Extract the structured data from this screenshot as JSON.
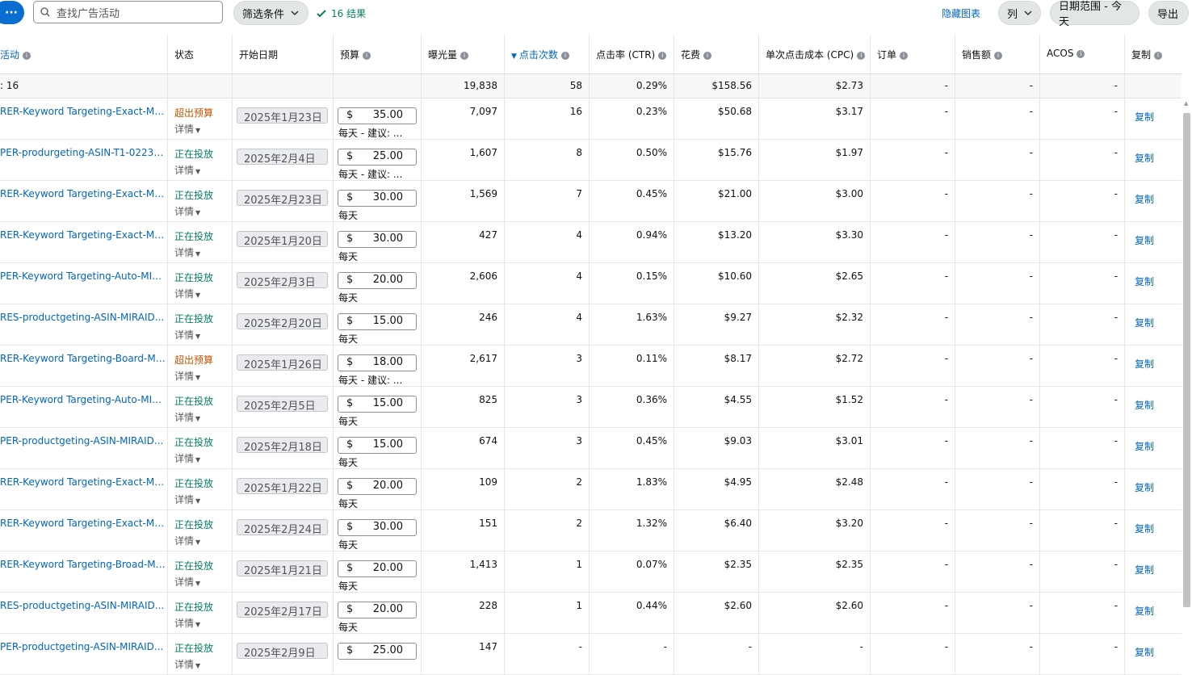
{
  "toolbar": {
    "more_label": "···",
    "search_placeholder": "查找广告活动",
    "filter_label": "筛选条件",
    "results_label": "16 结果",
    "hide_chart": "隐藏图表",
    "columns_label": "列",
    "date_range": "日期范围 - 今天",
    "export_label": "导出"
  },
  "headers": {
    "campaign": "活动",
    "status": "状态",
    "start_date": "开始日期",
    "budget": "预算",
    "impressions": "曝光量",
    "clicks": "点击次数",
    "ctr": "点击率 (CTR)",
    "spend": "花费",
    "cpc": "单次点击成本 (CPC)",
    "orders": "订单",
    "sales": "销售额",
    "acos": "ACOS",
    "copy": "复制"
  },
  "summary": {
    "label": ": 16",
    "impressions": "19,838",
    "clicks": "58",
    "ctr": "0.29%",
    "spend": "$158.56",
    "cpc": "$2.73",
    "orders": "-",
    "sales": "-",
    "acos": "-"
  },
  "detail_label": "详情",
  "copy_label": "复制",
  "currency": "$",
  "rows": [
    {
      "campaign": "RER-Keyword Targeting-Exact-MI...",
      "status": "超出预算",
      "status_type": "over",
      "start": "2025年1月23日",
      "budget": "35.00",
      "budget_note": "每天 - 建议: ...",
      "impressions": "7,097",
      "clicks": "16",
      "ctr": "0.23%",
      "spend": "$50.68",
      "cpc": "$3.17",
      "orders": "-",
      "sales": "-",
      "acos": "-"
    },
    {
      "campaign": "PER-produrgeting-ASIN-T1-0223(...",
      "status": "正在投放",
      "status_type": "on",
      "start": "2025年2月4日",
      "budget": "25.00",
      "budget_note": "每天 - 建议: ...",
      "impressions": "1,607",
      "clicks": "8",
      "ctr": "0.50%",
      "spend": "$15.76",
      "cpc": "$1.97",
      "orders": "-",
      "sales": "-",
      "acos": "-"
    },
    {
      "campaign": "RER-Keyword Targeting-Exact-MI...",
      "status": "正在投放",
      "status_type": "on",
      "start": "2025年2月23日",
      "budget": "30.00",
      "budget_note": "每天",
      "impressions": "1,569",
      "clicks": "7",
      "ctr": "0.45%",
      "spend": "$21.00",
      "cpc": "$3.00",
      "orders": "-",
      "sales": "-",
      "acos": "-"
    },
    {
      "campaign": "RER-Keyword Targeting-Exact-MI...",
      "status": "正在投放",
      "status_type": "on",
      "start": "2025年1月20日",
      "budget": "30.00",
      "budget_note": "每天",
      "impressions": "427",
      "clicks": "4",
      "ctr": "0.94%",
      "spend": "$13.20",
      "cpc": "$3.30",
      "orders": "-",
      "sales": "-",
      "acos": "-"
    },
    {
      "campaign": "PER-Keyword Targeting-Auto-MIR...",
      "status": "正在投放",
      "status_type": "on",
      "start": "2025年2月3日",
      "budget": "20.00",
      "budget_note": "每天",
      "impressions": "2,606",
      "clicks": "4",
      "ctr": "0.15%",
      "spend": "$10.60",
      "cpc": "$2.65",
      "orders": "-",
      "sales": "-",
      "acos": "-"
    },
    {
      "campaign": "RES-productgeting-ASIN-MIRAID...",
      "status": "正在投放",
      "status_type": "on",
      "start": "2025年2月20日",
      "budget": "15.00",
      "budget_note": "每天",
      "impressions": "246",
      "clicks": "4",
      "ctr": "1.63%",
      "spend": "$9.27",
      "cpc": "$2.32",
      "orders": "-",
      "sales": "-",
      "acos": "-"
    },
    {
      "campaign": "RER-Keyword Targeting-Board-MI...",
      "status": "超出预算",
      "status_type": "over",
      "start": "2025年1月26日",
      "budget": "18.00",
      "budget_note": "每天 - 建议: ...",
      "impressions": "2,617",
      "clicks": "3",
      "ctr": "0.11%",
      "spend": "$8.17",
      "cpc": "$2.72",
      "orders": "-",
      "sales": "-",
      "acos": "-"
    },
    {
      "campaign": "PER-Keyword Targeting-Auto-MIR...",
      "status": "正在投放",
      "status_type": "on",
      "start": "2025年2月5日",
      "budget": "15.00",
      "budget_note": "每天",
      "impressions": "825",
      "clicks": "3",
      "ctr": "0.36%",
      "spend": "$4.55",
      "cpc": "$1.52",
      "orders": "-",
      "sales": "-",
      "acos": "-"
    },
    {
      "campaign": "PER-productgeting-ASIN-MIRAID...",
      "status": "正在投放",
      "status_type": "on",
      "start": "2025年2月18日",
      "budget": "15.00",
      "budget_note": "每天",
      "impressions": "674",
      "clicks": "3",
      "ctr": "0.45%",
      "spend": "$9.03",
      "cpc": "$3.01",
      "orders": "-",
      "sales": "-",
      "acos": "-"
    },
    {
      "campaign": "RER-Keyword Targeting-Exact-MI...",
      "status": "正在投放",
      "status_type": "on",
      "start": "2025年1月22日",
      "budget": "20.00",
      "budget_note": "每天",
      "impressions": "109",
      "clicks": "2",
      "ctr": "1.83%",
      "spend": "$4.95",
      "cpc": "$2.48",
      "orders": "-",
      "sales": "-",
      "acos": "-"
    },
    {
      "campaign": "RER-Keyword Targeting-Exact-MI...",
      "status": "正在投放",
      "status_type": "on",
      "start": "2025年2月24日",
      "budget": "30.00",
      "budget_note": "每天",
      "impressions": "151",
      "clicks": "2",
      "ctr": "1.32%",
      "spend": "$6.40",
      "cpc": "$3.20",
      "orders": "-",
      "sales": "-",
      "acos": "-"
    },
    {
      "campaign": "RER-Keyword Targeting-Broad-MI...",
      "status": "正在投放",
      "status_type": "on",
      "start": "2025年1月21日",
      "budget": "20.00",
      "budget_note": "每天",
      "impressions": "1,413",
      "clicks": "1",
      "ctr": "0.07%",
      "spend": "$2.35",
      "cpc": "$2.35",
      "orders": "-",
      "sales": "-",
      "acos": "-"
    },
    {
      "campaign": "RES-productgeting-ASIN-MIRAID...",
      "status": "正在投放",
      "status_type": "on",
      "start": "2025年2月17日",
      "budget": "20.00",
      "budget_note": "每天",
      "impressions": "228",
      "clicks": "1",
      "ctr": "0.44%",
      "spend": "$2.60",
      "cpc": "$2.60",
      "orders": "-",
      "sales": "-",
      "acos": "-"
    },
    {
      "campaign": "PER-productgeting-ASIN-MIRAID...",
      "status": "正在投放",
      "status_type": "on",
      "start": "2025年2月9日",
      "budget": "25.00",
      "budget_note": "",
      "impressions": "147",
      "clicks": "-",
      "ctr": "-",
      "spend": "-",
      "cpc": "-",
      "orders": "-",
      "sales": "-",
      "acos": "-"
    }
  ]
}
